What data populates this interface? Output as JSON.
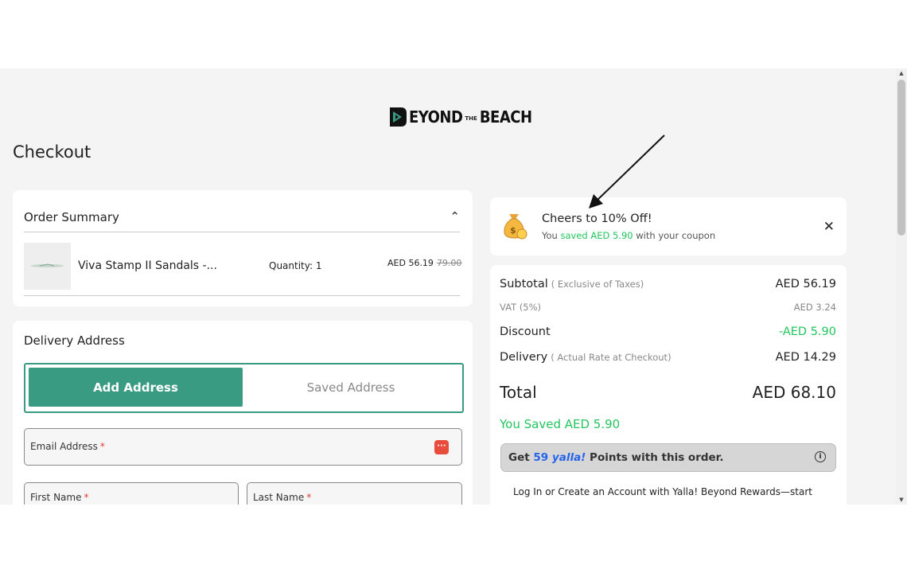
{
  "brand": {
    "logo_text_1": "EYOND",
    "logo_the": "THE",
    "logo_text_2": "BEACH",
    "accent": "#3a9b83"
  },
  "page": {
    "title": "Checkout"
  },
  "order_summary": {
    "heading": "Order Summary",
    "items": [
      {
        "name": "Viva Stamp II Sandals -...",
        "quantity_label": "Quantity:",
        "quantity": "1",
        "price": "AED 56.19",
        "original_price": "79.00"
      }
    ]
  },
  "delivery": {
    "heading": "Delivery Address",
    "tabs": {
      "add": "Add Address",
      "saved": "Saved Address"
    },
    "fields": {
      "email": "Email Address",
      "first_name": "First Name",
      "last_name": "Last Name",
      "required_mark": "*"
    }
  },
  "coupon": {
    "title": "Cheers to 10% Off!",
    "sub_prefix": "You",
    "sub_saved": "saved AED 5.90",
    "sub_suffix": "with your coupon",
    "close": "✕"
  },
  "summary": {
    "subtotal": {
      "label": "Subtotal",
      "note": "( Exclusive of Taxes)",
      "value": "AED 56.19"
    },
    "vat": {
      "label": "VAT (5%)",
      "value": "AED 3.24"
    },
    "discount": {
      "label": "Discount",
      "value": "-AED 5.90"
    },
    "delivery": {
      "label": "Delivery",
      "note": "( Actual Rate at Checkout)",
      "value": "AED 14.29"
    },
    "total": {
      "label": "Total",
      "value": "AED 68.10"
    },
    "saved": "You Saved AED 5.90",
    "yalla": {
      "prefix": "Get",
      "points": "59",
      "brand": "yalla!",
      "suffix": "Points with this order.",
      "info_icon": "ⓘ"
    },
    "rewards_text": "Log In or Create an Account with Yalla! Beyond Rewards—start"
  },
  "colors": {
    "green": "#22c55e",
    "red": "#e53935"
  }
}
